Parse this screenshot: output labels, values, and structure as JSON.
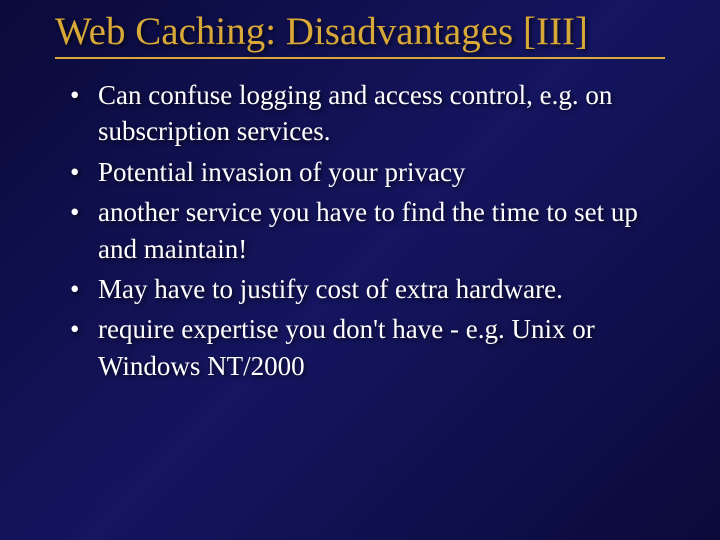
{
  "slide": {
    "title": "Web Caching: Disadvantages [III]",
    "bullets": [
      "Can confuse logging and access control, e.g. on subscription services.",
      "Potential invasion of your privacy",
      "another service you have to find the time to set up and maintain!",
      "May have to justify cost of extra hardware.",
      "require expertise you don't have - e.g. Unix or Windows NT/2000"
    ]
  }
}
